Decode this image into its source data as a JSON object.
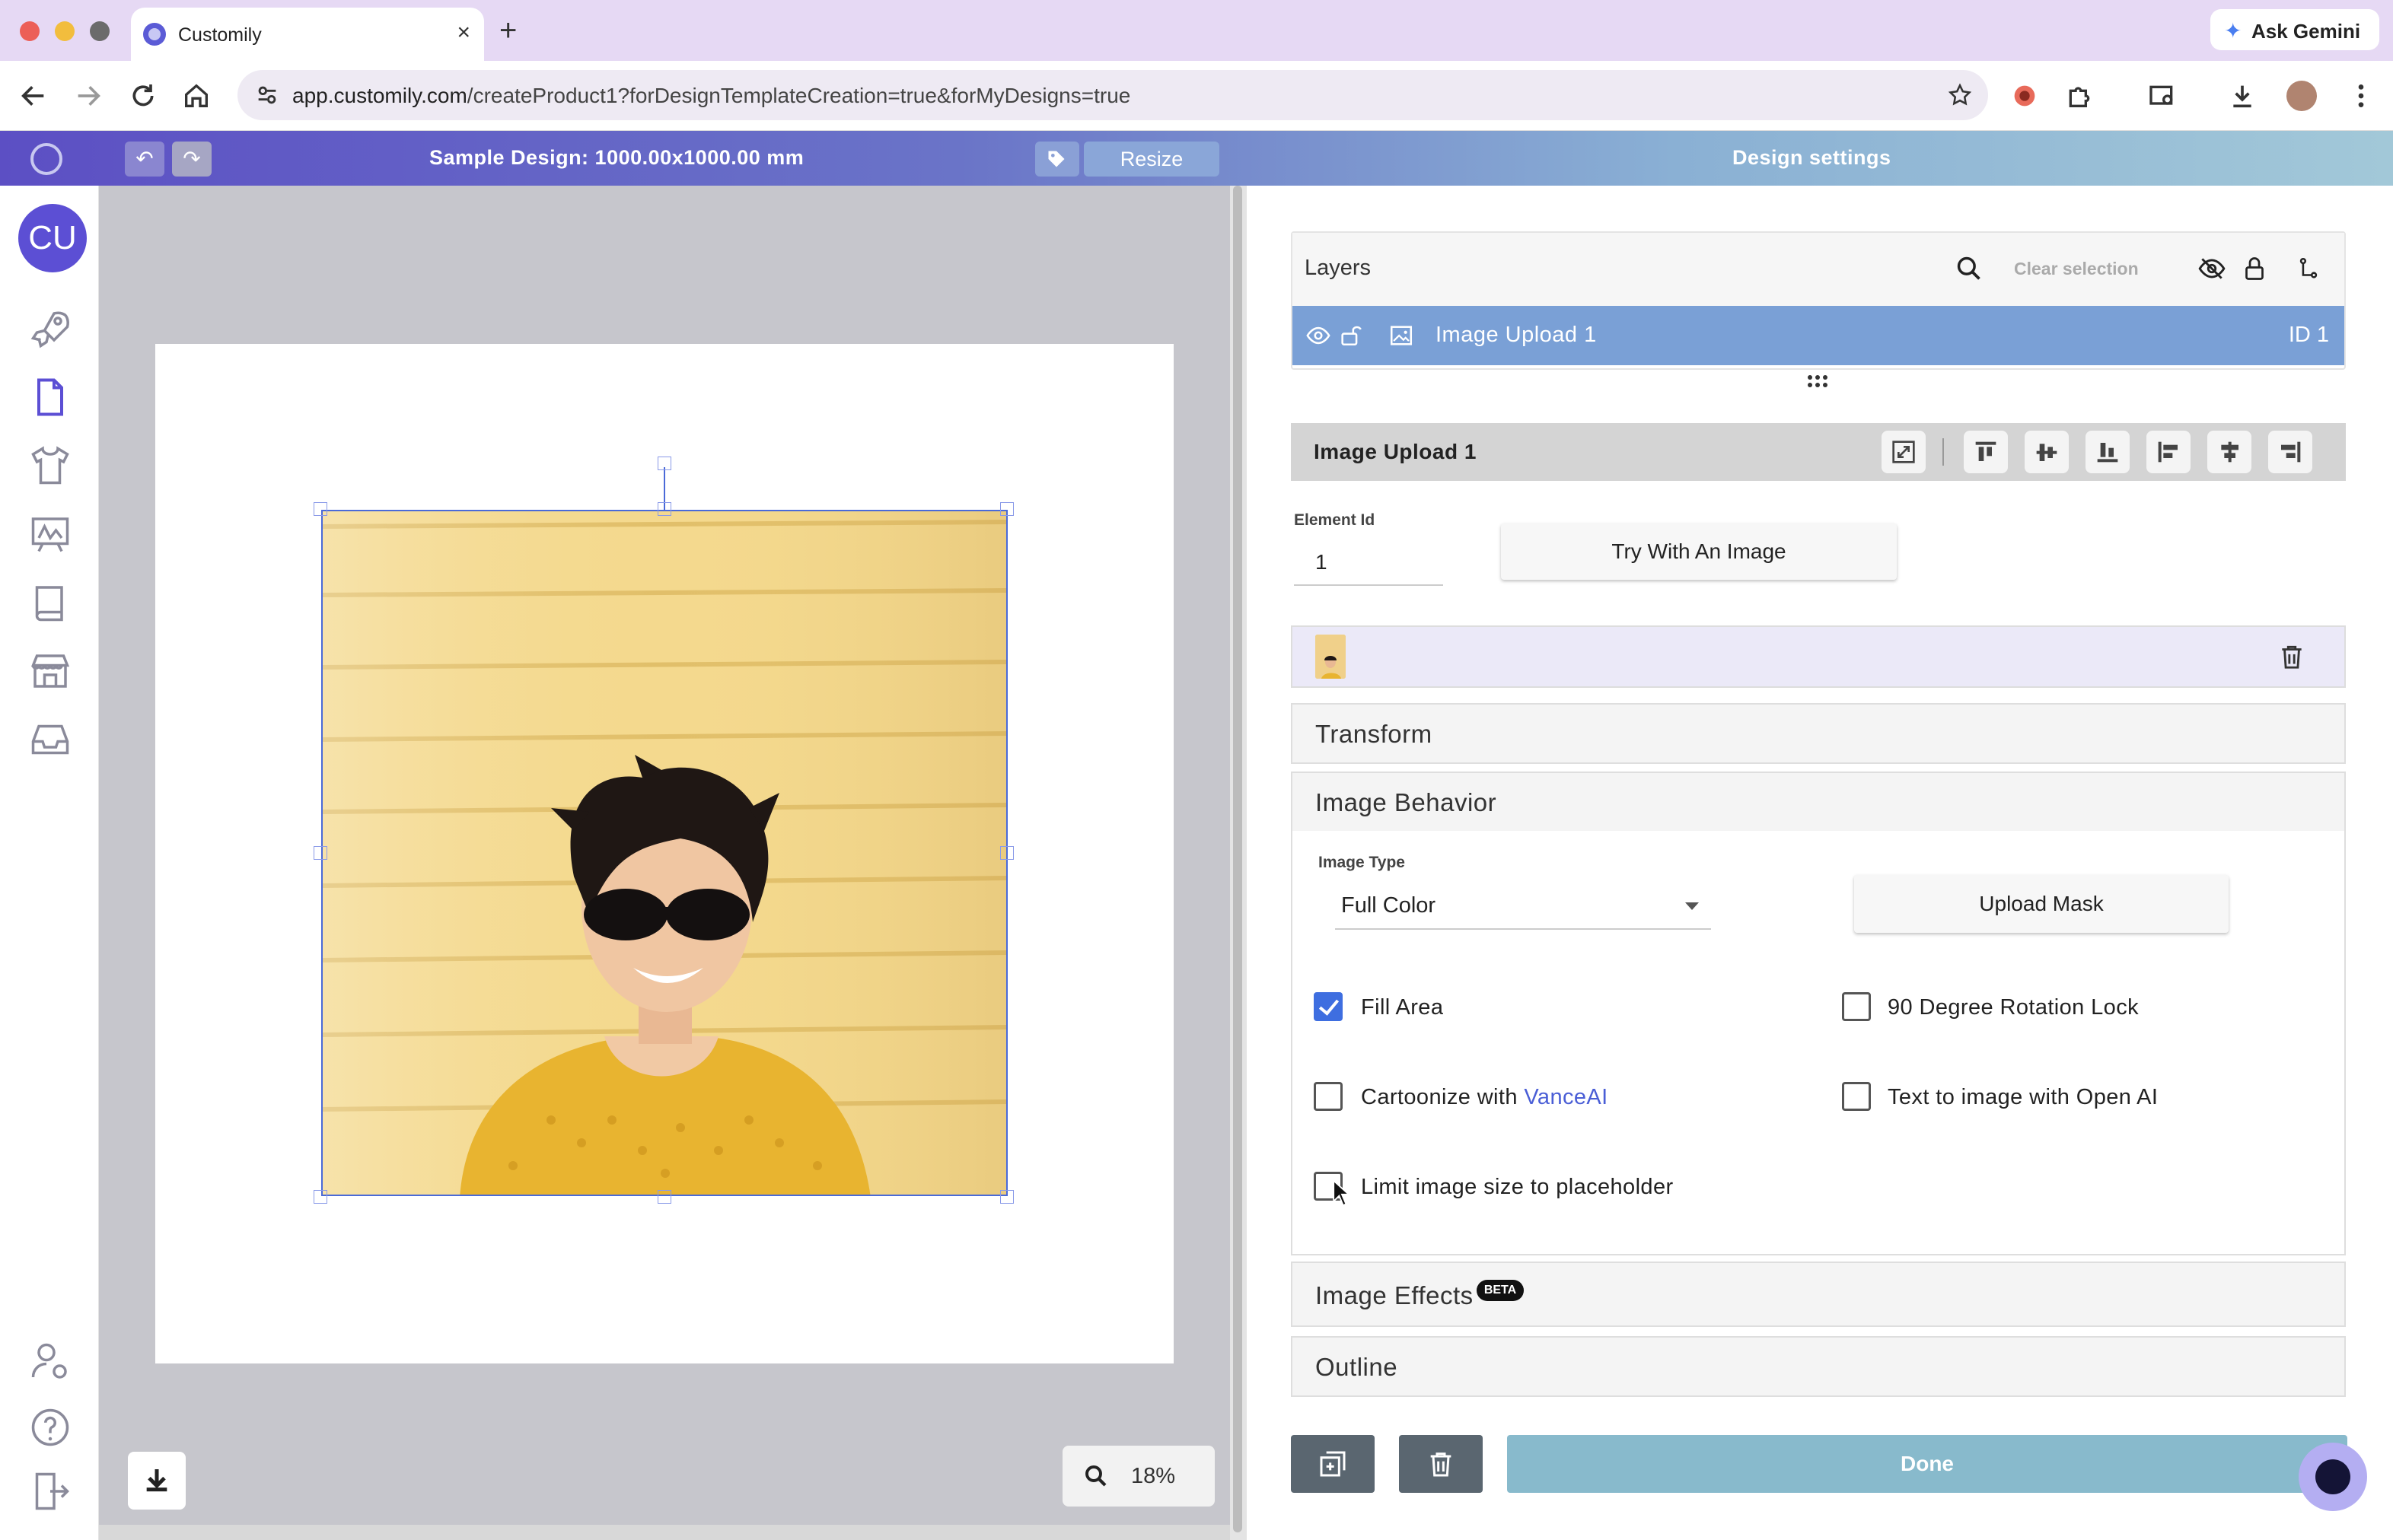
{
  "browser": {
    "tab_title": "Customily",
    "new_tab": "+",
    "close_tab": "×",
    "gemini_label": "Ask Gemini",
    "url_host": "app.customily.com",
    "url_path": "/createProduct1?forDesignTemplateCreation=true&forMyDesigns=true"
  },
  "header": {
    "design_title": "Sample Design: 1000.00x1000.00 mm",
    "resize_label": "Resize",
    "panel_title": "Design settings"
  },
  "sidebar": {
    "avatar_initials": "CU"
  },
  "canvas": {
    "zoom": "18%"
  },
  "layers": {
    "title": "Layers",
    "clear_selection": "Clear selection",
    "items": [
      {
        "name": "Image Upload 1",
        "id": "ID 1"
      }
    ]
  },
  "element": {
    "name": "Image Upload 1",
    "id_label": "Element Id",
    "id_value": "1",
    "try_button": "Try With An Image"
  },
  "sections": {
    "transform": "Transform",
    "image_behavior": "Image Behavior",
    "image_effects": "Image Effects",
    "beta": "BETA",
    "outline": "Outline"
  },
  "behavior": {
    "image_type_label": "Image Type",
    "image_type_value": "Full Color",
    "upload_mask": "Upload Mask",
    "fill_area": {
      "label": "Fill Area",
      "checked": true
    },
    "rotation_lock": {
      "label": "90 Degree Rotation Lock",
      "checked": false
    },
    "cartoonize": {
      "label": "Cartoonize with ",
      "link": "VanceAI",
      "checked": false
    },
    "text_to_image": {
      "label": "Text to image with Open AI",
      "checked": false
    },
    "limit_size": {
      "label": "Limit image size to placeholder",
      "checked": false
    }
  },
  "footer": {
    "done": "Done"
  },
  "colors": {
    "accent": "#5c4fd4",
    "checkbox_on": "#3e6ee0",
    "layer_selected": "#7aa0d6",
    "done_button": "#88bacc"
  }
}
